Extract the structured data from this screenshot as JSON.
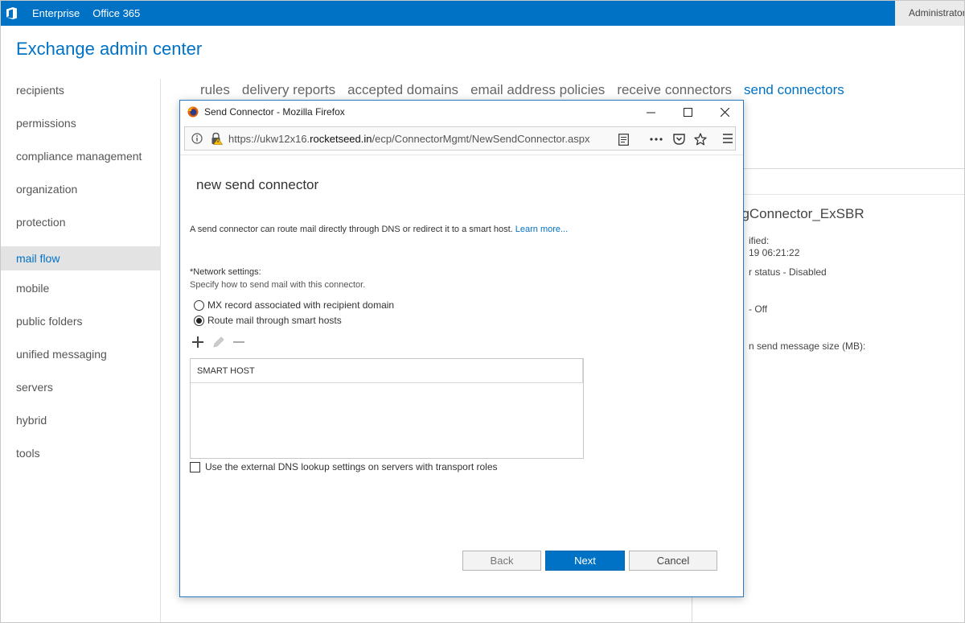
{
  "topbar": {
    "nav": [
      "Enterprise",
      "Office 365"
    ],
    "user": "Administrator"
  },
  "app_title": "Exchange admin center",
  "sidebar": {
    "items": [
      {
        "label": "recipients"
      },
      {
        "label": "permissions"
      },
      {
        "label": "compliance management"
      },
      {
        "label": "organization"
      },
      {
        "label": "protection"
      },
      {
        "label": "mail flow",
        "active": true
      },
      {
        "label": "mobile"
      },
      {
        "label": "public folders"
      },
      {
        "label": "unified messaging"
      },
      {
        "label": "servers"
      },
      {
        "label": "hybrid"
      },
      {
        "label": "tools"
      }
    ]
  },
  "tabs": [
    {
      "label": "rules"
    },
    {
      "label": "delivery reports"
    },
    {
      "label": "accepted domains"
    },
    {
      "label": "email address policies"
    },
    {
      "label": "receive connectors"
    },
    {
      "label": "send connectors",
      "active": true
    }
  ],
  "detail_pane": {
    "title": "ngConnector_ExSBR",
    "line1": "ified:",
    "line2": "19 06:21:22",
    "line3": "r status - Disabled",
    "line4": "- Off",
    "line5": "n send message size (MB):"
  },
  "popup": {
    "window_title": "Send Connector - Mozilla Firefox",
    "url_prefix": "https://ukw12x16.",
    "url_domain": "rocketseed.in",
    "url_suffix": "/ecp/ConnectorMgmt/NewSendConnector.aspx",
    "dialog_title": "new send connector",
    "description": "A send connector can route mail directly through DNS or redirect it to a smart host.",
    "learn_more": "Learn more...",
    "network_label": "*Network settings:",
    "network_sub": "Specify how to send mail with this connector.",
    "radio_mx": "MX record associated with recipient domain",
    "radio_smart": "Route mail through smart hosts",
    "selected_option": "Route mail through smart hosts",
    "grid_header": "SMART HOST",
    "dns_checkbox": "Use the external DNS lookup settings on servers with transport roles",
    "dns_checked": false,
    "buttons": {
      "back": "Back",
      "next": "Next",
      "cancel": "Cancel"
    }
  },
  "colors": {
    "brand": "#0072c6",
    "topbar": "#0072c6",
    "active_nav_bg": "#e3e3e3"
  }
}
